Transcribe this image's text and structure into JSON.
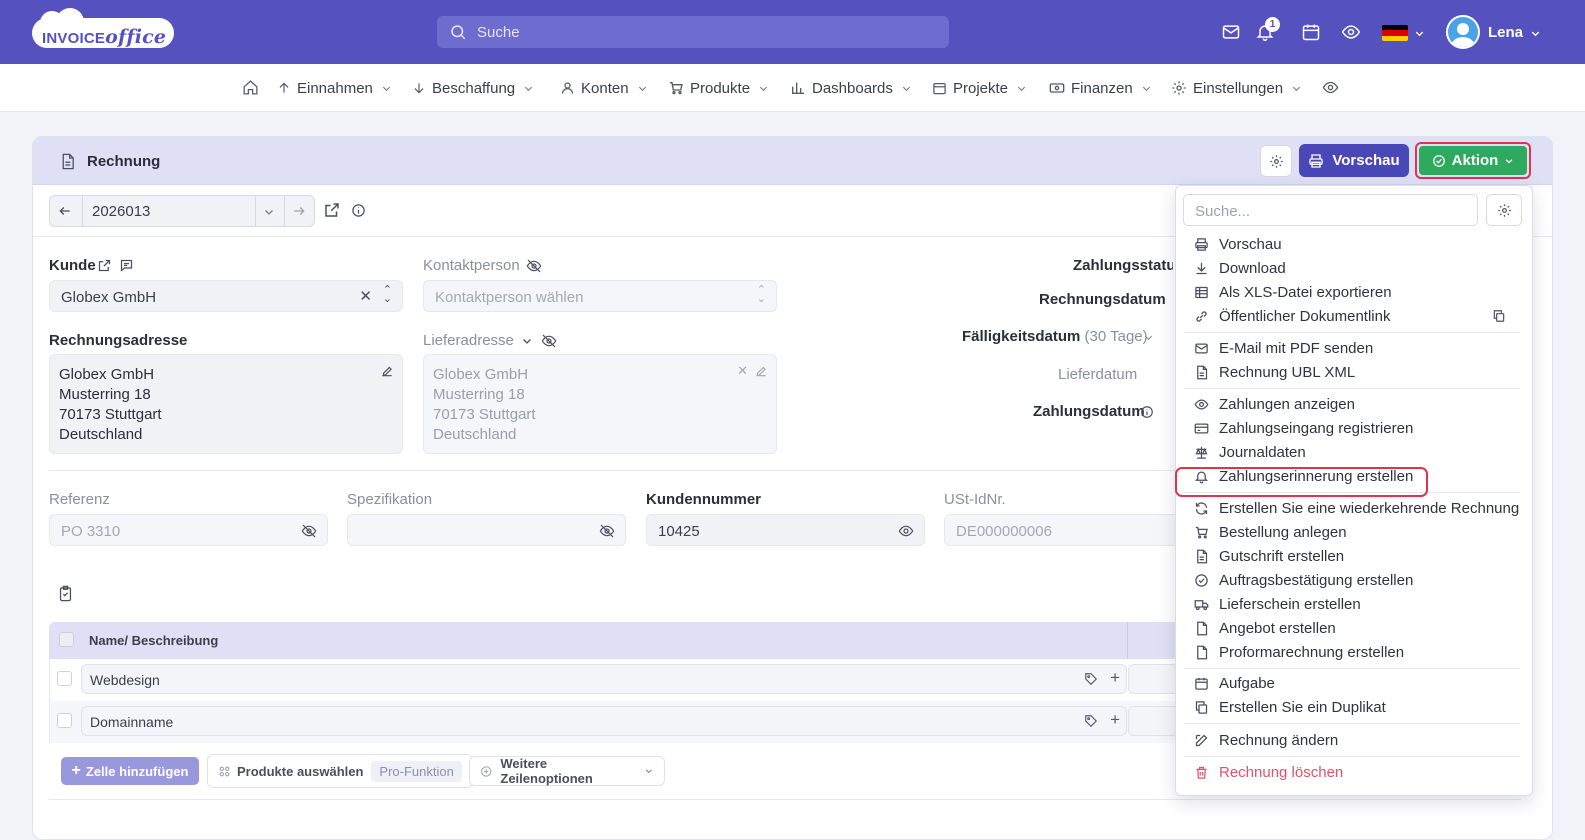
{
  "app": {
    "logo_a": "INVOICE",
    "logo_b": "office"
  },
  "topbar": {
    "search_placeholder": "Suche",
    "notification_count": "1",
    "user_name": "Lena"
  },
  "nav": [
    {
      "label": "Einnahmen",
      "icon": "arrow-up-icon"
    },
    {
      "label": "Beschaffung",
      "icon": "arrow-down-icon"
    },
    {
      "label": "Konten",
      "icon": "user-icon"
    },
    {
      "label": "Produkte",
      "icon": "cart-icon"
    },
    {
      "label": "Dashboards",
      "icon": "chart-icon"
    },
    {
      "label": "Projekte",
      "icon": "calendar-icon"
    },
    {
      "label": "Finanzen",
      "icon": "money-icon"
    },
    {
      "label": "Einstellungen",
      "icon": "gear-icon"
    }
  ],
  "doc": {
    "title": "Rechnung",
    "preview_label": "Vorschau",
    "action_label": "Aktion",
    "number": "2026013",
    "customer_label": "Kunde",
    "customer_value": "Globex GmbH",
    "contact_label": "Kontaktperson",
    "contact_placeholder": "Kontaktperson wählen",
    "billing_label": "Rechnungsadresse",
    "billing_lines": [
      "Globex GmbH",
      "Musterring 18",
      "70173 Stuttgart",
      "Deutschland"
    ],
    "delivery_label": "Lieferadresse",
    "delivery_lines": [
      "Globex GmbH",
      "Musterring 18",
      "70173 Stuttgart",
      "Deutschland"
    ],
    "payment_status_label": "Zahlungsstatus",
    "invoice_date_label": "Rechnungsdatum",
    "due_date_label": "Fälligkeitsdatum",
    "due_days": "(30 Tage)",
    "delivery_date_label": "Lieferdatum",
    "payment_date_label": "Zahlungsdatum",
    "reference_label": "Referenz",
    "reference_value": "PO 3310",
    "spec_label": "Spezifikation",
    "customer_number_label": "Kundennummer",
    "customer_number_value": "10425",
    "vat_label": "USt-IdNr.",
    "vat_value": "DE000000006"
  },
  "table": {
    "header_name": "Name/ Beschreibung",
    "rows": [
      "Webdesign",
      "Domainname"
    ],
    "add_row": "Zelle hinzufügen",
    "select_products": "Produkte auswählen",
    "pro_badge": "Pro-Funktion",
    "more_options": "Weitere Zeilenoptionen"
  },
  "dropdown": {
    "search_placeholder": "Suche...",
    "items": [
      {
        "label": "Vorschau",
        "icon": "printer-icon"
      },
      {
        "label": "Download",
        "icon": "download-icon"
      },
      {
        "label": "Als XLS-Datei exportieren",
        "icon": "table-icon"
      },
      {
        "label": "Öffentlicher Dokumentlink",
        "icon": "link-icon"
      },
      {
        "label": "E-Mail mit PDF senden",
        "icon": "mail-icon"
      },
      {
        "label": "Rechnung UBL XML",
        "icon": "file-icon"
      },
      {
        "label": "Zahlungen anzeigen",
        "icon": "eye-icon"
      },
      {
        "label": "Zahlungseingang registrieren",
        "icon": "credit-card-icon"
      },
      {
        "label": "Journaldaten",
        "icon": "scale-icon"
      },
      {
        "label": "Zahlungserinnerung erstellen",
        "icon": "bell-icon"
      },
      {
        "label": "Erstellen Sie eine wiederkehrende Rechnung",
        "icon": "refresh-icon"
      },
      {
        "label": "Bestellung anlegen",
        "icon": "cart-icon"
      },
      {
        "label": "Gutschrift erstellen",
        "icon": "file-icon"
      },
      {
        "label": "Auftragsbestätigung erstellen",
        "icon": "check-circle-icon"
      },
      {
        "label": "Lieferschein erstellen",
        "icon": "truck-icon"
      },
      {
        "label": "Angebot erstellen",
        "icon": "file-icon"
      },
      {
        "label": "Proformarechnung erstellen",
        "icon": "file-icon"
      },
      {
        "label": "Aufgabe",
        "icon": "calendar-icon"
      },
      {
        "label": "Erstellen Sie ein Duplikat",
        "icon": "copy-icon"
      },
      {
        "label": "Rechnung ändern",
        "icon": "edit-icon"
      },
      {
        "label": "Rechnung löschen",
        "icon": "trash-icon"
      }
    ]
  },
  "colors": {
    "brand": "#5552c0",
    "action": "#2eaa5e",
    "danger": "#e0536a",
    "highlight": "#e0334c"
  }
}
